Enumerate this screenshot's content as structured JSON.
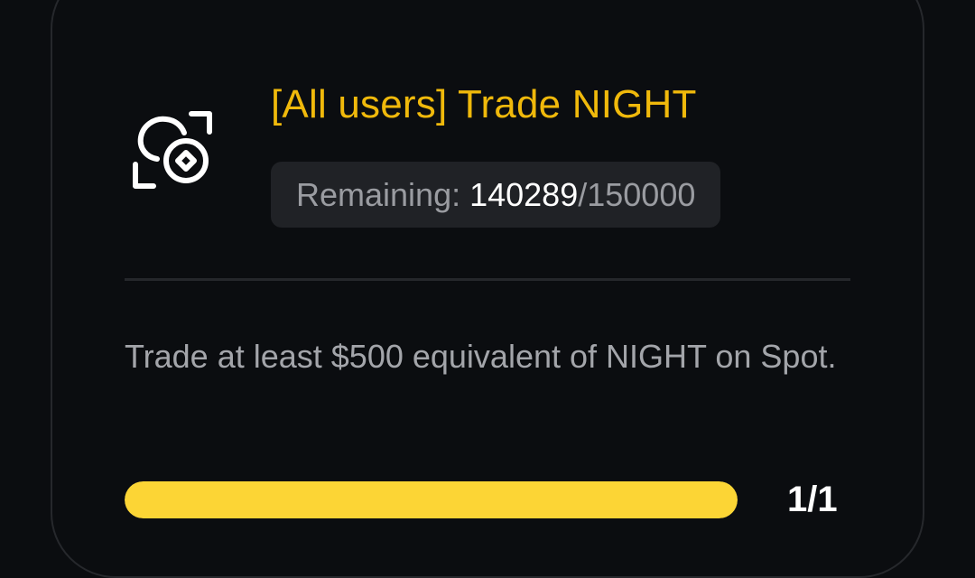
{
  "task": {
    "icon": "scan-coin-icon",
    "title": "[All users] Trade NIGHT",
    "remaining": {
      "label": "Remaining: ",
      "current": "140289",
      "total": "/150000"
    },
    "description": "Trade at least $500 equivalent of NIGHT on Spot.",
    "progress": {
      "fraction": 1.0,
      "text": "1/1"
    }
  },
  "colors": {
    "background": "#0b0d10",
    "title": "#f0b90b",
    "progress_fill": "#fcd535",
    "badge_bg": "#202226"
  }
}
